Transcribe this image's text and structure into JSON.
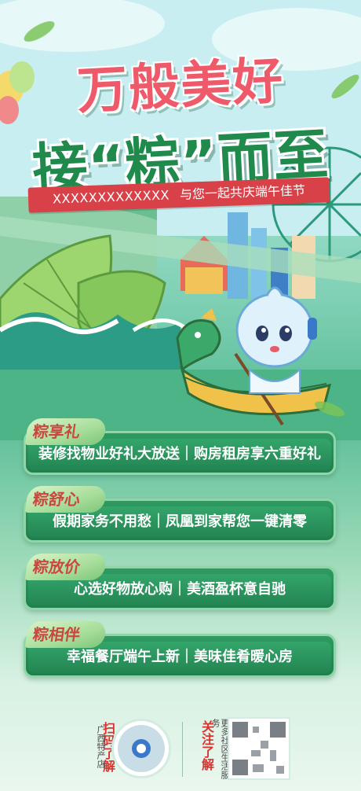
{
  "headline": {
    "line1": "万般美好",
    "line2": "接“粽”而至"
  },
  "banner": {
    "account": "XXXXXXXXXXXXX",
    "slogan": "与您一起共庆端午佳节"
  },
  "benefits": [
    {
      "tag": "粽享礼",
      "text": "装修找物业好礼大放送｜购房租房享六重好礼"
    },
    {
      "tag": "粽舒心",
      "text": "假期家务不用愁｜凤凰到家帮您一键清零"
    },
    {
      "tag": "粽放价",
      "text": "心选好物放心购｜美酒盈杯意自驰"
    },
    {
      "tag": "粽相伴",
      "text": "幸福餐厅端午上新｜美味佳肴暖心房"
    }
  ],
  "footer": {
    "scan_label": "扫码了解",
    "store_name": "广西特产店",
    "follow_label": "关注了解",
    "service_label": "更多社区生活服务"
  },
  "colors": {
    "headline_red": "#ef5a6a",
    "headline_green": "#1f8a4c",
    "banner_red": "#d94148",
    "card_green": "#2e9a62",
    "tag_text": "#c9473f"
  }
}
